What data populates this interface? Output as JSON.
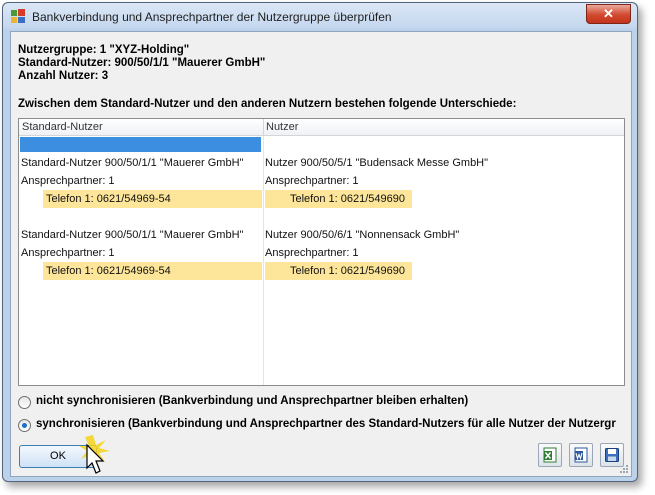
{
  "window": {
    "title": "Bankverbindung und Ansprechpartner der Nutzergruppe überprüfen",
    "close_label": "✕"
  },
  "info": {
    "group": "Nutzergruppe: 1 \"XYZ-Holding\"",
    "standard_user": "Standard-Nutzer: 900/50/1/1 \"Mauerer GmbH\"",
    "count": "Anzahl Nutzer: 3"
  },
  "differences_label": "Zwischen dem Standard-Nutzer und den anderen Nutzern bestehen folgende Unterschiede:",
  "grid": {
    "columns": [
      "Standard-Nutzer",
      "Nutzer"
    ],
    "rows": [
      {
        "a": "Standard-Nutzer 900/50/1/1 \"Mauerer GmbH\"",
        "b": "Nutzer 900/50/5/1 \"Budensack Messe GmbH\""
      },
      {
        "a": "Ansprechpartner: 1",
        "b": "Ansprechpartner: 1"
      },
      {
        "a": "Telefon 1: 0621/54969-54",
        "b": "Telefon 1: 0621/549690"
      },
      {
        "a": "Standard-Nutzer 900/50/1/1 \"Mauerer GmbH\"",
        "b": "Nutzer 900/50/6/1 \"Nonnensack GmbH\""
      },
      {
        "a": "Ansprechpartner: 1",
        "b": "Ansprechpartner: 1"
      },
      {
        "a": "Telefon 1: 0621/54969-54",
        "b": "Telefon 1: 0621/549690"
      }
    ]
  },
  "options": {
    "no_sync": "nicht synchronisieren (Bankverbindung und Ansprechpartner bleiben erhalten)",
    "sync": "synchronisieren (Bankverbindung und Ansprechpartner des Standard-Nutzers für alle Nutzer der Nutzergr",
    "selected": "sync"
  },
  "buttons": {
    "ok": "OK"
  },
  "icons": {
    "excel": "excel-export-icon",
    "word": "word-export-icon",
    "save": "save-icon"
  },
  "colors": {
    "highlight": "#fde59a",
    "selection": "#3c8fe0"
  }
}
